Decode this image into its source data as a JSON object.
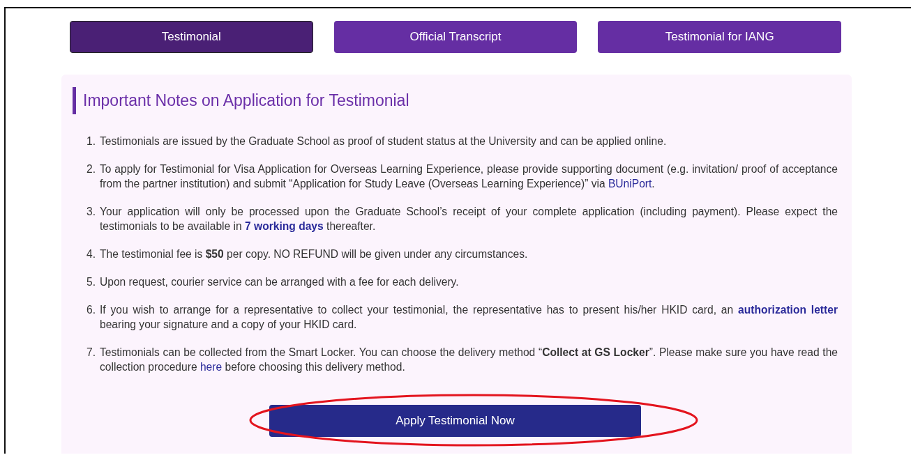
{
  "tabs": [
    {
      "label": "Testimonial",
      "selected": true
    },
    {
      "label": "Official Transcript",
      "selected": false
    },
    {
      "label": "Testimonial for IANG",
      "selected": false
    }
  ],
  "notes": {
    "title": "Important Notes on Application for Testimonial",
    "items": [
      {
        "number": "1.",
        "parts": [
          {
            "kind": "text",
            "text": "Testimonials are issued by the Graduate School as proof of student status at the University and can be applied online."
          }
        ]
      },
      {
        "number": "2.",
        "parts": [
          {
            "kind": "text",
            "text": "To apply for Testimonial for Visa Application for Overseas Learning Experience, please provide supporting document (e.g. invitation/ proof of acceptance from the partner institution) and submit “Application for Study Leave (Overseas Learning Experience)” via "
          },
          {
            "kind": "link",
            "text": "BUniPort"
          },
          {
            "kind": "text",
            "text": "."
          }
        ]
      },
      {
        "number": "3.",
        "parts": [
          {
            "kind": "text",
            "text": "Your application will only be processed upon the Graduate School’s receipt of your complete application (including payment). Please expect the testimonials to be available in "
          },
          {
            "kind": "strong_link",
            "text": "7 working days"
          },
          {
            "kind": "text",
            "text": " thereafter."
          }
        ]
      },
      {
        "number": "4.",
        "parts": [
          {
            "kind": "text",
            "text": "The testimonial fee is **$50** per copy. NO REFUND will be given under any circumstances."
          }
        ]
      },
      {
        "number": "5.",
        "parts": [
          {
            "kind": "text",
            "text": "Upon request, courier service can be arranged with a fee for each delivery."
          }
        ]
      },
      {
        "number": "6.",
        "parts": [
          {
            "kind": "text",
            "text": "If you wish to arrange for a representative to collect your testimonial, the representative has to present his/her HKID card, an "
          },
          {
            "kind": "strong_link",
            "text": "authorization letter"
          },
          {
            "kind": "text",
            "text": " bearing your signature and a copy of your HKID card."
          }
        ]
      },
      {
        "number": "7.",
        "parts": [
          {
            "kind": "text",
            "text": "Testimonials can be collected from the Smart Locker. You can choose the delivery method “**Collect at GS Locker**”. Please make sure you have read the collection procedure "
          },
          {
            "kind": "link",
            "text": "here"
          },
          {
            "kind": "text",
            "text": " before choosing this delivery method."
          }
        ]
      }
    ]
  },
  "apply_button": {
    "label": "Apply Testimonial Now",
    "highlighted": true
  }
}
